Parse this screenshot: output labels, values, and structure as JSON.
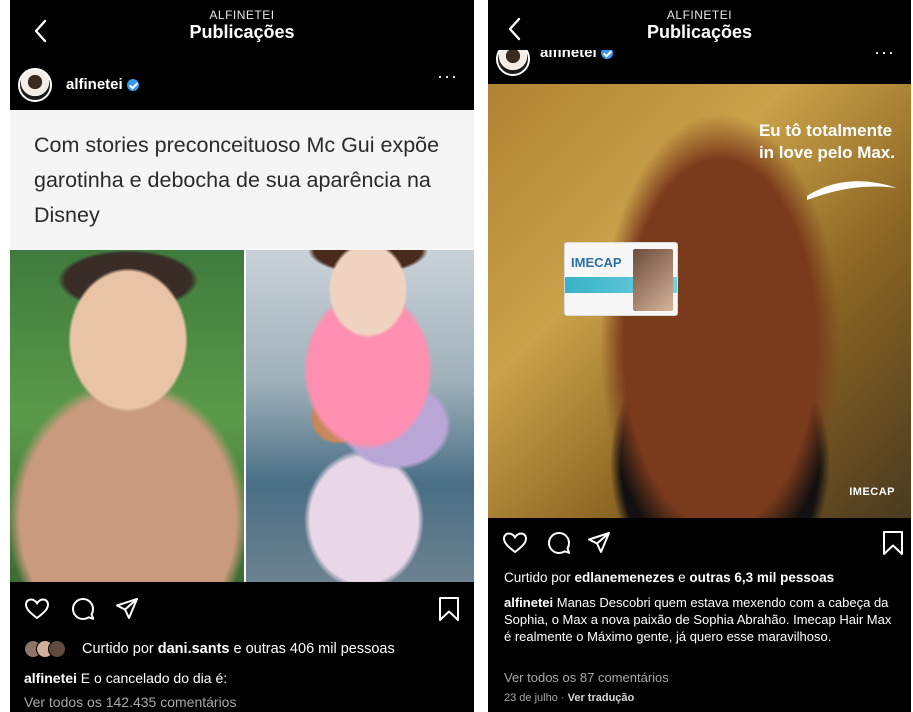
{
  "left": {
    "header_sub": "ALFINETEI",
    "header_title": "Publicações",
    "username": "alfinetei",
    "more": "···",
    "post_text": "Com stories preconceituoso Mc Gui expõe garotinha e debocha de sua aparência na Disney",
    "likes_prefix": "Curtido por ",
    "likes_user": "dani.sants",
    "likes_suffix": " e outras 406 mil pessoas",
    "caption_user": "alfinetei",
    "caption_text": " E o cancelado do dia é:",
    "comments_link": "Ver todos os 142.435 comentários"
  },
  "right": {
    "header_sub": "ALFINETEI",
    "header_title": "Publicações",
    "username": "alfinetei",
    "more": "···",
    "ad_line1": "Eu tô totalmente",
    "ad_line2": "in love pelo Max.",
    "product_name": "IMECAP",
    "ad_logo": "IMECAP",
    "likes_prefix": "Curtido por ",
    "likes_user": "edlanemenezes",
    "likes_mid": " e ",
    "likes_suffix": "outras 6,3 mil pessoas",
    "caption_user": "alfinetei",
    "caption_text": " Manas Descobri quem estava mexendo com a cabeça da Sophia, o Max a nova paixão de Sophia Abrahão. Imecap Hair Max é realmente o Máximo gente, já quero esse maravilhoso.",
    "comments_link": "Ver todos os 87 comentários",
    "date": "23 de julho",
    "date_sep": " · ",
    "translate": "Ver tradução"
  },
  "icons": [
    "back-chevron-icon",
    "verified-badge-icon",
    "heart-icon",
    "comment-icon",
    "share-icon",
    "bookmark-icon"
  ],
  "colors": {
    "background": "#000000",
    "verified": "#3897f0",
    "muted_text": "#a8a8a8",
    "post_text_bg": "#f5f5f5"
  }
}
